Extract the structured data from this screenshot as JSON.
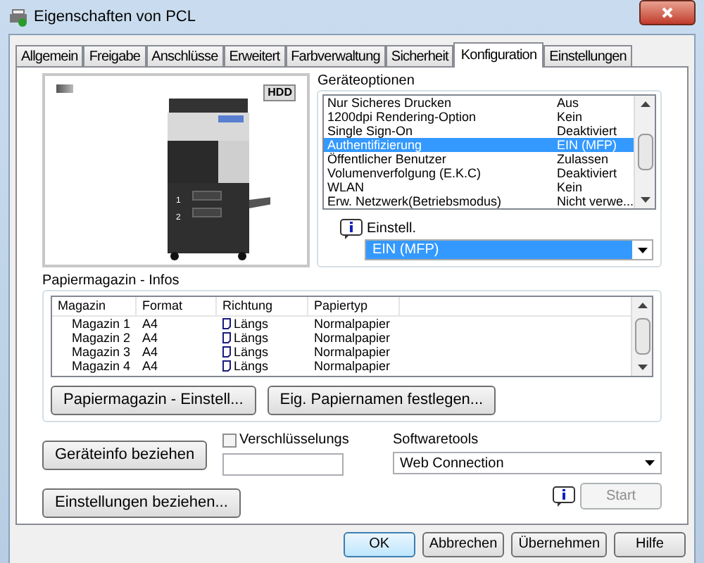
{
  "window": {
    "title": "Eigenschaften von PCL"
  },
  "tabs": [
    {
      "label": "Allgemein",
      "selected": false
    },
    {
      "label": "Freigabe",
      "selected": false
    },
    {
      "label": "Anschlüsse",
      "selected": false
    },
    {
      "label": "Erweitert",
      "selected": false
    },
    {
      "label": "Farbverwaltung",
      "selected": false
    },
    {
      "label": "Sicherheit",
      "selected": false
    },
    {
      "label": "Konfiguration",
      "selected": true
    },
    {
      "label": "Einstellungen",
      "selected": false
    }
  ],
  "device_image": {
    "badge": "HDD",
    "tray_labels": [
      "1",
      "2"
    ]
  },
  "device_options": {
    "title": "Geräteoptionen",
    "rows": [
      {
        "name": "Nur Sicheres Drucken",
        "value": "Aus",
        "selected": false
      },
      {
        "name": "1200dpi Rendering-Option",
        "value": "Kein",
        "selected": false
      },
      {
        "name": "Single Sign-On",
        "value": "Deaktiviert",
        "selected": false
      },
      {
        "name": "Authentifizierung",
        "value": "EIN (MFP)",
        "selected": true
      },
      {
        "name": "Öffentlicher Benutzer",
        "value": "Zulassen",
        "selected": false
      },
      {
        "name": "Volumenverfolgung (E.K.C)",
        "value": "Deaktiviert",
        "selected": false
      },
      {
        "name": "WLAN",
        "value": "Kein",
        "selected": false
      },
      {
        "name": "Erw. Netzwerk(Betriebsmodus)",
        "value": "Nicht verwe...",
        "selected": false
      }
    ],
    "setting_label": "Einstell.",
    "setting_value": "EIN (MFP)"
  },
  "paper_trays": {
    "title": "Papiermagazin - Infos",
    "columns": [
      "Magazin",
      "Format",
      "Richtung",
      "Papiertyp"
    ],
    "rows": [
      [
        "Magazin 1",
        "A4",
        "Längs",
        "Normalpapier"
      ],
      [
        "Magazin 2",
        "A4",
        "Längs",
        "Normalpapier"
      ],
      [
        "Magazin 3",
        "A4",
        "Längs",
        "Normalpapier"
      ],
      [
        "Magazin 4",
        "A4",
        "Längs",
        "Normalpapier"
      ]
    ],
    "buttons": [
      "Papiermagazin - Einstell...",
      "Eig. Papiernamen festlegen..."
    ]
  },
  "device_info_button": "Geräteinfo beziehen",
  "settings_button": "Einstellungen beziehen...",
  "encryption": {
    "label": "Verschlüsselungs",
    "checked": false
  },
  "software_tools": {
    "label": "Softwaretools",
    "value": "Web Connection",
    "start": "Start",
    "start_disabled": true
  },
  "buttons": [
    {
      "label": "OK",
      "default": true
    },
    {
      "label": "Abbrechen",
      "default": false
    },
    {
      "label": "Übernehmen",
      "default": false
    },
    {
      "label": "Hilfe",
      "default": false
    }
  ]
}
